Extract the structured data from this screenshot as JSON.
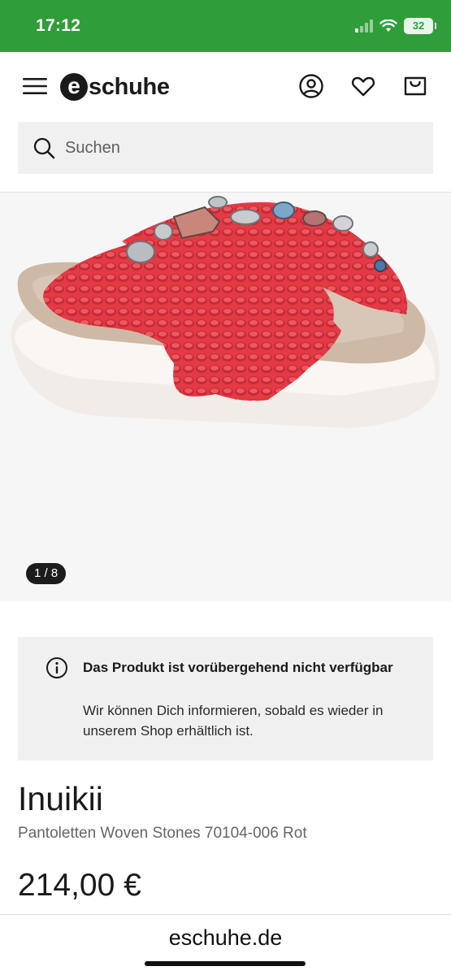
{
  "status_bar": {
    "time": "17:12",
    "battery": "32",
    "icons": [
      "signal-icon",
      "wifi-icon",
      "battery-icon"
    ]
  },
  "header": {
    "logo_mark": "e",
    "logo_text": "schuhe",
    "icons": [
      "menu-icon",
      "account-icon",
      "heart-icon",
      "cart-icon"
    ]
  },
  "search": {
    "placeholder": "Suchen",
    "icon": "search-icon"
  },
  "gallery": {
    "counter": "1 / 8",
    "image": "red woven crossover slide sandal with gemstones"
  },
  "notice": {
    "icon": "info-icon",
    "title": "Das Produkt ist vorübergehend nicht verfügbar",
    "body": "Wir können Dich informieren, sobald es wieder in unserem Shop erhältlich ist."
  },
  "product": {
    "brand": "Inuikii",
    "name": "Pantoletten Woven Stones 70104-006 Rot",
    "price": "214,00 €"
  },
  "browser": {
    "url": "eschuhe.de"
  },
  "colors": {
    "status_green": "#2f9e3a",
    "sandal_red": "#e23b45",
    "panel_gray": "#f0f0f0"
  }
}
